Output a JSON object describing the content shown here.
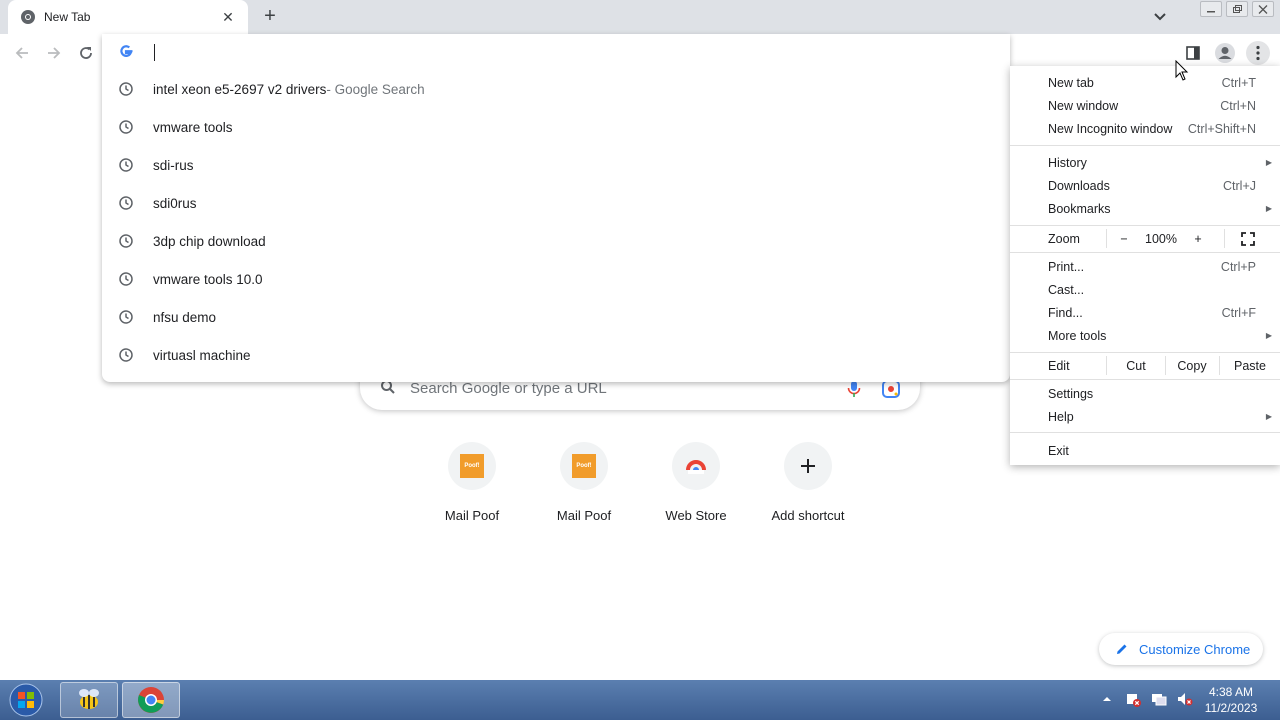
{
  "tab": {
    "title": "New Tab"
  },
  "omnibox": {
    "suggestions": [
      {
        "text": "intel xeon e5-2697 v2 drivers",
        "suffix": " - Google Search"
      },
      {
        "text": "vmware tools",
        "suffix": ""
      },
      {
        "text": "sdi-rus",
        "suffix": ""
      },
      {
        "text": "sdi0rus",
        "suffix": ""
      },
      {
        "text": "3dp chip download",
        "suffix": ""
      },
      {
        "text": "vmware tools 10.0",
        "suffix": ""
      },
      {
        "text": "nfsu demo",
        "suffix": ""
      },
      {
        "text": "virtuasl machine",
        "suffix": ""
      }
    ]
  },
  "ntp": {
    "search_placeholder": "Search Google or type a URL",
    "shortcuts": [
      {
        "label": "Mail Poof",
        "icon": "Poof!"
      },
      {
        "label": "Mail Poof",
        "icon": "Poof!"
      },
      {
        "label": "Web Store"
      },
      {
        "label": "Add shortcut"
      }
    ],
    "customize_label": "Customize Chrome"
  },
  "menu": {
    "new_tab": {
      "label": "New tab",
      "shortcut": "Ctrl+T"
    },
    "new_window": {
      "label": "New window",
      "shortcut": "Ctrl+N"
    },
    "new_incognito": {
      "label": "New Incognito window",
      "shortcut": "Ctrl+Shift+N"
    },
    "history": {
      "label": "History"
    },
    "downloads": {
      "label": "Downloads",
      "shortcut": "Ctrl+J"
    },
    "bookmarks": {
      "label": "Bookmarks"
    },
    "zoom": {
      "label": "Zoom",
      "minus": "−",
      "value": "100%",
      "plus": "+"
    },
    "print": {
      "label": "Print...",
      "shortcut": "Ctrl+P"
    },
    "cast": {
      "label": "Cast..."
    },
    "find": {
      "label": "Find...",
      "shortcut": "Ctrl+F"
    },
    "more_tools": {
      "label": "More tools"
    },
    "edit": {
      "label": "Edit",
      "cut": "Cut",
      "copy": "Copy",
      "paste": "Paste"
    },
    "settings": {
      "label": "Settings"
    },
    "help": {
      "label": "Help"
    },
    "exit": {
      "label": "Exit"
    }
  },
  "taskbar": {
    "time": "4:38 AM",
    "date": "11/2/2023"
  },
  "colors": {
    "accent": "#1a73e8",
    "tabstrip": "#dee1e6",
    "taskbar": "#3c5e91"
  }
}
